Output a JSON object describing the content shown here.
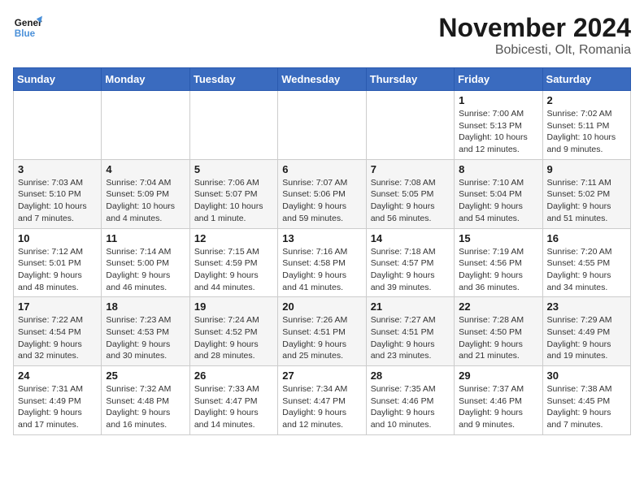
{
  "logo": {
    "text_general": "General",
    "text_blue": "Blue"
  },
  "title": "November 2024",
  "location": "Bobicesti, Olt, Romania",
  "days_of_week": [
    "Sunday",
    "Monday",
    "Tuesday",
    "Wednesday",
    "Thursday",
    "Friday",
    "Saturday"
  ],
  "weeks": [
    [
      {
        "day": "",
        "info": ""
      },
      {
        "day": "",
        "info": ""
      },
      {
        "day": "",
        "info": ""
      },
      {
        "day": "",
        "info": ""
      },
      {
        "day": "",
        "info": ""
      },
      {
        "day": "1",
        "info": "Sunrise: 7:00 AM\nSunset: 5:13 PM\nDaylight: 10 hours and 12 minutes."
      },
      {
        "day": "2",
        "info": "Sunrise: 7:02 AM\nSunset: 5:11 PM\nDaylight: 10 hours and 9 minutes."
      }
    ],
    [
      {
        "day": "3",
        "info": "Sunrise: 7:03 AM\nSunset: 5:10 PM\nDaylight: 10 hours and 7 minutes."
      },
      {
        "day": "4",
        "info": "Sunrise: 7:04 AM\nSunset: 5:09 PM\nDaylight: 10 hours and 4 minutes."
      },
      {
        "day": "5",
        "info": "Sunrise: 7:06 AM\nSunset: 5:07 PM\nDaylight: 10 hours and 1 minute."
      },
      {
        "day": "6",
        "info": "Sunrise: 7:07 AM\nSunset: 5:06 PM\nDaylight: 9 hours and 59 minutes."
      },
      {
        "day": "7",
        "info": "Sunrise: 7:08 AM\nSunset: 5:05 PM\nDaylight: 9 hours and 56 minutes."
      },
      {
        "day": "8",
        "info": "Sunrise: 7:10 AM\nSunset: 5:04 PM\nDaylight: 9 hours and 54 minutes."
      },
      {
        "day": "9",
        "info": "Sunrise: 7:11 AM\nSunset: 5:02 PM\nDaylight: 9 hours and 51 minutes."
      }
    ],
    [
      {
        "day": "10",
        "info": "Sunrise: 7:12 AM\nSunset: 5:01 PM\nDaylight: 9 hours and 48 minutes."
      },
      {
        "day": "11",
        "info": "Sunrise: 7:14 AM\nSunset: 5:00 PM\nDaylight: 9 hours and 46 minutes."
      },
      {
        "day": "12",
        "info": "Sunrise: 7:15 AM\nSunset: 4:59 PM\nDaylight: 9 hours and 44 minutes."
      },
      {
        "day": "13",
        "info": "Sunrise: 7:16 AM\nSunset: 4:58 PM\nDaylight: 9 hours and 41 minutes."
      },
      {
        "day": "14",
        "info": "Sunrise: 7:18 AM\nSunset: 4:57 PM\nDaylight: 9 hours and 39 minutes."
      },
      {
        "day": "15",
        "info": "Sunrise: 7:19 AM\nSunset: 4:56 PM\nDaylight: 9 hours and 36 minutes."
      },
      {
        "day": "16",
        "info": "Sunrise: 7:20 AM\nSunset: 4:55 PM\nDaylight: 9 hours and 34 minutes."
      }
    ],
    [
      {
        "day": "17",
        "info": "Sunrise: 7:22 AM\nSunset: 4:54 PM\nDaylight: 9 hours and 32 minutes."
      },
      {
        "day": "18",
        "info": "Sunrise: 7:23 AM\nSunset: 4:53 PM\nDaylight: 9 hours and 30 minutes."
      },
      {
        "day": "19",
        "info": "Sunrise: 7:24 AM\nSunset: 4:52 PM\nDaylight: 9 hours and 28 minutes."
      },
      {
        "day": "20",
        "info": "Sunrise: 7:26 AM\nSunset: 4:51 PM\nDaylight: 9 hours and 25 minutes."
      },
      {
        "day": "21",
        "info": "Sunrise: 7:27 AM\nSunset: 4:51 PM\nDaylight: 9 hours and 23 minutes."
      },
      {
        "day": "22",
        "info": "Sunrise: 7:28 AM\nSunset: 4:50 PM\nDaylight: 9 hours and 21 minutes."
      },
      {
        "day": "23",
        "info": "Sunrise: 7:29 AM\nSunset: 4:49 PM\nDaylight: 9 hours and 19 minutes."
      }
    ],
    [
      {
        "day": "24",
        "info": "Sunrise: 7:31 AM\nSunset: 4:49 PM\nDaylight: 9 hours and 17 minutes."
      },
      {
        "day": "25",
        "info": "Sunrise: 7:32 AM\nSunset: 4:48 PM\nDaylight: 9 hours and 16 minutes."
      },
      {
        "day": "26",
        "info": "Sunrise: 7:33 AM\nSunset: 4:47 PM\nDaylight: 9 hours and 14 minutes."
      },
      {
        "day": "27",
        "info": "Sunrise: 7:34 AM\nSunset: 4:47 PM\nDaylight: 9 hours and 12 minutes."
      },
      {
        "day": "28",
        "info": "Sunrise: 7:35 AM\nSunset: 4:46 PM\nDaylight: 9 hours and 10 minutes."
      },
      {
        "day": "29",
        "info": "Sunrise: 7:37 AM\nSunset: 4:46 PM\nDaylight: 9 hours and 9 minutes."
      },
      {
        "day": "30",
        "info": "Sunrise: 7:38 AM\nSunset: 4:45 PM\nDaylight: 9 hours and 7 minutes."
      }
    ]
  ]
}
